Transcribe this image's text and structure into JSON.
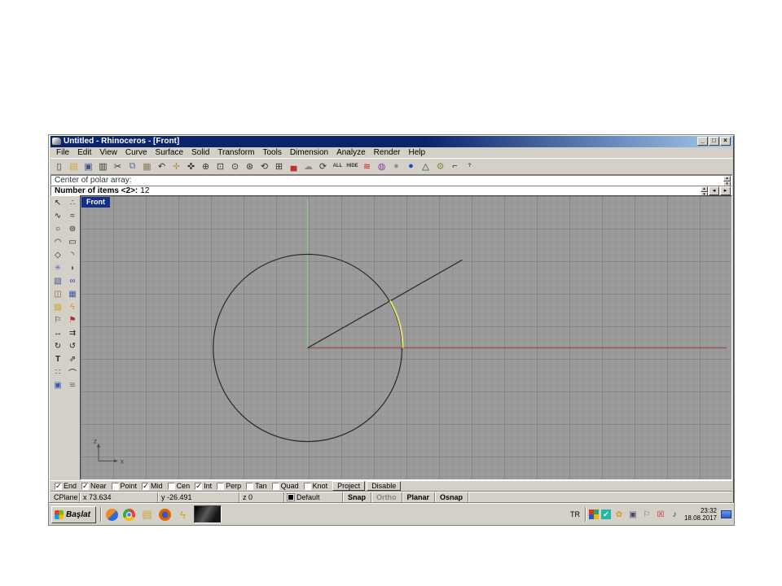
{
  "colors": {
    "chrome": "#d4d0c8",
    "titlebar_a": "#0a246a",
    "titlebar_b": "#a6caf0",
    "viewport_bg": "#9b9b9b",
    "axis_x": "#9b4f4f",
    "axis_y": "#8fbc8f",
    "preview_arc": "#e3e370",
    "curve": "#262626",
    "front_bg": "#142f85"
  },
  "window": {
    "title": "Untitled - Rhinoceros - [Front]",
    "controls": {
      "minimize": "_",
      "restore": "□",
      "close": "×"
    }
  },
  "menu": {
    "items": [
      {
        "name": "menu-file",
        "label": "File"
      },
      {
        "name": "menu-edit",
        "label": "Edit"
      },
      {
        "name": "menu-view",
        "label": "View"
      },
      {
        "name": "menu-curve",
        "label": "Curve"
      },
      {
        "name": "menu-surface",
        "label": "Surface"
      },
      {
        "name": "menu-solid",
        "label": "Solid"
      },
      {
        "name": "menu-transform",
        "label": "Transform"
      },
      {
        "name": "menu-tools",
        "label": "Tools"
      },
      {
        "name": "menu-dimension",
        "label": "Dimension"
      },
      {
        "name": "menu-analyze",
        "label": "Analyze"
      },
      {
        "name": "menu-render",
        "label": "Render"
      },
      {
        "name": "menu-help",
        "label": "Help"
      }
    ]
  },
  "toolbar": {
    "icons": [
      {
        "name": "new-file-icon",
        "glyph": "▯"
      },
      {
        "name": "open-file-icon",
        "glyph": "▤",
        "color": "#caa53d"
      },
      {
        "name": "save-icon",
        "glyph": "▣",
        "color": "#44518e"
      },
      {
        "name": "print-icon",
        "glyph": "▥"
      },
      {
        "name": "cut-icon",
        "glyph": "✂"
      },
      {
        "name": "copy-icon",
        "glyph": "⧉",
        "color": "#5b6ea8"
      },
      {
        "name": "paste-icon",
        "glyph": "▦",
        "color": "#8a7f5a"
      },
      {
        "name": "undo-icon",
        "glyph": "↶"
      },
      {
        "name": "pan-icon",
        "glyph": "✛",
        "color": "#b08d4f"
      },
      {
        "name": "rotate-view-icon",
        "glyph": "✜"
      },
      {
        "name": "zoom-dynamic-icon",
        "glyph": "⊕"
      },
      {
        "name": "zoom-window-icon",
        "glyph": "⊡"
      },
      {
        "name": "zoom-selected-icon",
        "glyph": "⊙"
      },
      {
        "name": "zoom-extents-icon",
        "glyph": "⊛"
      },
      {
        "name": "undo-view-icon",
        "glyph": "⟲"
      },
      {
        "name": "viewport-layout-icon",
        "glyph": "⊞"
      },
      {
        "name": "render-car-icon",
        "glyph": "▄",
        "color": "#c03030"
      },
      {
        "name": "shade-icon",
        "glyph": "☁",
        "color": "#8a8a8a"
      },
      {
        "name": "select-cycle-icon",
        "glyph": "⟳"
      },
      {
        "name": "zoom-all-icon",
        "glyph": "ALL",
        "text": true
      },
      {
        "name": "hide-icon",
        "glyph": "HIDE",
        "text": true
      },
      {
        "name": "rhino-render-icon",
        "glyph": "≋",
        "color": "#cc2222"
      },
      {
        "name": "color-wheel-icon",
        "glyph": "◍",
        "color": "#7a3fa0"
      },
      {
        "name": "render-preview-icon",
        "glyph": "●",
        "color": "#909090"
      },
      {
        "name": "shaded-view-icon",
        "glyph": "●",
        "color": "#2244cc"
      },
      {
        "name": "cone-icon",
        "glyph": "△"
      },
      {
        "name": "options-gear-icon",
        "glyph": "⚙",
        "color": "#8a8a3a"
      },
      {
        "name": "dimension-tool-icon",
        "glyph": "⌐"
      },
      {
        "name": "help-icon",
        "glyph": "?",
        "text": true
      }
    ]
  },
  "command": {
    "history": "Center of polar array:",
    "prompt": "Number of items <2>:",
    "value": "12",
    "controls": {
      "spin_up": "▴",
      "spin_down": "▾",
      "prev": "◂",
      "next": "▸"
    }
  },
  "viewport": {
    "label": "Front",
    "axis_z": "z",
    "axis_x": "x"
  },
  "sidebar": {
    "icons": [
      {
        "name": "select-arrow-icon",
        "glyph": "↖"
      },
      {
        "name": "point-icon",
        "glyph": "∴"
      },
      {
        "name": "curve-icon",
        "glyph": "∿"
      },
      {
        "name": "curve-interp-icon",
        "glyph": "≈"
      },
      {
        "name": "circle-icon",
        "glyph": "○"
      },
      {
        "name": "ellipse-icon",
        "glyph": "⊜"
      },
      {
        "name": "arc-icon",
        "glyph": "◠"
      },
      {
        "name": "rectangle-icon",
        "glyph": "▭"
      },
      {
        "name": "polygon-icon",
        "glyph": "◇"
      },
      {
        "name": "fillet-icon",
        "glyph": "◝"
      },
      {
        "name": "surface-icon",
        "glyph": "✳",
        "color": "#6a6aa0"
      },
      {
        "name": "patch-icon",
        "glyph": "◗",
        "color": "#3a5a9a"
      },
      {
        "name": "box-icon",
        "glyph": "▧",
        "color": "#44518e"
      },
      {
        "name": "sphere-icon",
        "glyph": "∞",
        "color": "#2a4a9a"
      },
      {
        "name": "cylinder-icon",
        "glyph": "◫",
        "color": "#7a6a3a"
      },
      {
        "name": "mesh-icon",
        "glyph": "▦",
        "color": "#3a5a9a"
      },
      {
        "name": "layer-state-icon",
        "glyph": "▨",
        "color": "#c8a400"
      },
      {
        "name": "explode-icon",
        "glyph": "ϟ",
        "color": "#d89000"
      },
      {
        "name": "flag-white-icon",
        "glyph": "⚐"
      },
      {
        "name": "flag-red-icon",
        "glyph": "⚑",
        "color": "#a03030"
      },
      {
        "name": "move-icon",
        "glyph": "↔"
      },
      {
        "name": "copy-object-icon",
        "glyph": "⇉"
      },
      {
        "name": "rotate-icon",
        "glyph": "↻"
      },
      {
        "name": "rotate-3d-icon",
        "glyph": "↺"
      },
      {
        "name": "text-icon",
        "glyph": "T",
        "text": true
      },
      {
        "name": "scale-icon",
        "glyph": "⇗"
      },
      {
        "name": "array-icon",
        "glyph": "∷"
      },
      {
        "name": "dimension-arc-icon",
        "glyph": "⌒"
      },
      {
        "name": "layers-icon",
        "glyph": "▣",
        "color": "#2d5fae"
      },
      {
        "name": "hatch-icon",
        "glyph": "≋",
        "color": "#6a6a6a"
      }
    ]
  },
  "osnap": {
    "items": [
      {
        "name": "osnap-end",
        "label": "End",
        "checked": true
      },
      {
        "name": "osnap-near",
        "label": "Near",
        "checked": true
      },
      {
        "name": "osnap-point",
        "label": "Point",
        "checked": false
      },
      {
        "name": "osnap-mid",
        "label": "Mid",
        "checked": true
      },
      {
        "name": "osnap-cen",
        "label": "Cen",
        "checked": false
      },
      {
        "name": "osnap-int",
        "label": "Int",
        "checked": true
      },
      {
        "name": "osnap-perp",
        "label": "Perp",
        "checked": false
      },
      {
        "name": "osnap-tan",
        "label": "Tan",
        "checked": false
      },
      {
        "name": "osnap-quad",
        "label": "Quad",
        "checked": false
      },
      {
        "name": "osnap-knot",
        "label": "Knot",
        "checked": false
      }
    ],
    "project_label": "Project",
    "disable_label": "Disable"
  },
  "status": {
    "cplane": "CPlane",
    "x": "x 73.634",
    "y": "y -26.491",
    "z": "z 0",
    "layer": "Default",
    "panes": [
      {
        "name": "pane-snap",
        "label": "Snap"
      },
      {
        "name": "pane-ortho",
        "label": "Ortho",
        "dim": true
      },
      {
        "name": "pane-planar",
        "label": "Planar"
      },
      {
        "name": "pane-osnap",
        "label": "Osnap"
      }
    ]
  },
  "taskbar": {
    "start_label": "Başlat",
    "quicklaunch": [
      {
        "name": "media-player-icon",
        "cls": "ic-wmp"
      },
      {
        "name": "chrome-icon",
        "cls": "ic-chrome"
      },
      {
        "name": "folder-icon",
        "glyph": "▤",
        "color": "#caa53d"
      },
      {
        "name": "firefox-icon",
        "cls": "ic-firefox"
      },
      {
        "name": "rhino-launcher-icon",
        "glyph": "ϟ",
        "color": "#d4a017"
      }
    ],
    "tray": {
      "lang": "TR",
      "icons": [
        {
          "name": "program-grid-icon",
          "cls": "ic-quad"
        },
        {
          "name": "update-check-icon",
          "glyph": "✔",
          "cls": "ic-teal"
        },
        {
          "name": "gold-utility-icon",
          "glyph": "✿",
          "color": "#c8a020"
        },
        {
          "name": "display-settings-icon",
          "glyph": "▣",
          "color": "#444a66"
        },
        {
          "name": "flag-status-icon",
          "glyph": "⚐",
          "color": "#777777"
        },
        {
          "name": "network-error-icon",
          "glyph": "☒",
          "color": "#c03030"
        },
        {
          "name": "volume-icon",
          "glyph": "♪",
          "color": "#333333"
        }
      ],
      "time": "23:32",
      "date": "18.08.2017"
    }
  }
}
